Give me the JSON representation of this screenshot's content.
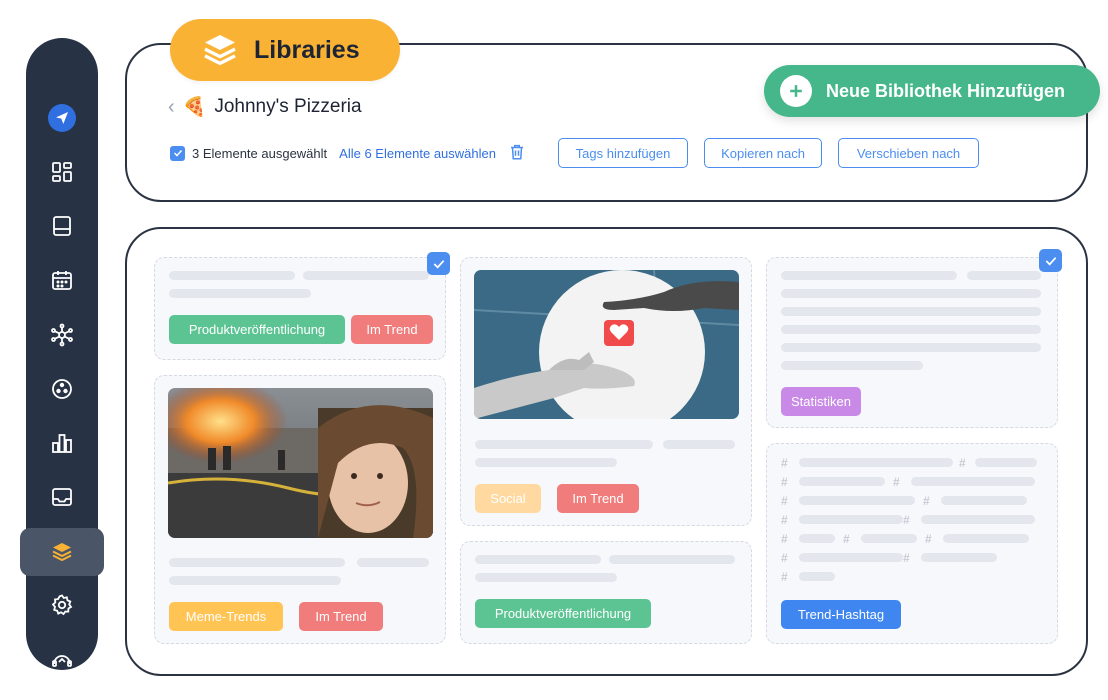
{
  "header": {
    "libraries_title": "Libraries",
    "add_library_label": "Neue Bibliothek Hinzufügen",
    "breadcrumb": {
      "emoji": "🍕",
      "name": "Johnny's Pizzeria"
    },
    "selection_text": "3 Elemente ausgewählt",
    "select_all_label": "Alle 6 Elemente auswählen",
    "actions": [
      "Tags hinzufügen",
      "Kopieren nach",
      "Verschieben nach"
    ]
  },
  "sidebar": {
    "icons": [
      "send-icon",
      "dashboard-icon",
      "posts-icon",
      "calendar-icon",
      "network-icon",
      "engage-icon",
      "analytics-icon",
      "inbox-icon",
      "libraries-icon",
      "settings-icon",
      "support-icon"
    ],
    "active": "libraries-icon"
  },
  "tags": {
    "product_release": "Produktveröffentlichung",
    "trending": "Im Trend",
    "meme_trends": "Meme-Trends",
    "social": "Social",
    "statistics": "Statistiken",
    "trend_hashtag": "Trend-Hashtag"
  },
  "colors": {
    "accent_blue": "#4b8ef0",
    "brand_green": "#46b78a",
    "brand_orange": "#f9b233",
    "sidebar": "#273244",
    "tag_green": "#5cc493",
    "tag_red": "#f07c7c",
    "tag_orange": "#ffc454",
    "tag_peach": "#ffd9a0",
    "tag_purple": "#c88ae6",
    "tag_blue": "#3f86f0"
  }
}
